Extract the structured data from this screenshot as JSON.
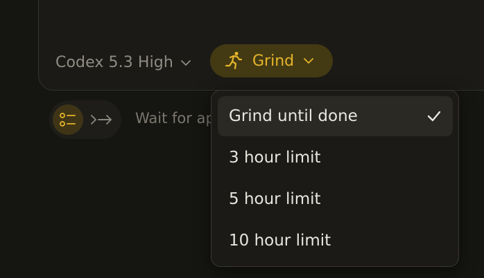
{
  "composer": {
    "model_label": "Codex 5.3 High",
    "mode_label": "Grind",
    "mode_icon": "running-person-icon"
  },
  "queue": {
    "list_icon": "checklist-icon",
    "send_icon": "double-arrow-right-icon",
    "status_text": "Wait for ap"
  },
  "menu": {
    "items": [
      {
        "label": "Grind until done",
        "selected": true
      },
      {
        "label": "3 hour limit",
        "selected": false
      },
      {
        "label": "5 hour limit",
        "selected": false
      },
      {
        "label": "10 hour limit",
        "selected": false
      }
    ]
  },
  "colors": {
    "background": "#151511",
    "accent": "#e6b52a",
    "accent_bg": "#433a14",
    "text_primary": "#e8e6df",
    "text_muted": "#8f8c84"
  }
}
